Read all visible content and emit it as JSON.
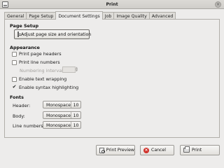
{
  "window": {
    "title": "Print"
  },
  "tabs": [
    "General",
    "Page Setup",
    "Document Settings",
    "Job",
    "Image Quality",
    "Advanced"
  ],
  "active_tab": "Document Settings",
  "page_setup": {
    "heading": "Page Setup",
    "button_label": "Adjust page size and orientation"
  },
  "appearance": {
    "heading": "Appearance",
    "print_page_headers": {
      "label": "Print page headers",
      "checked": false
    },
    "print_line_numbers": {
      "label": "Print line numbers",
      "checked": false
    },
    "numbering_interval": {
      "label": "Numbering interval:",
      "value": "",
      "enabled": false
    },
    "enable_text_wrapping": {
      "label": "Enable text wrapping",
      "checked": false
    },
    "enable_syntax_highlighting": {
      "label": "Enable syntax highlighting",
      "checked": true
    }
  },
  "fonts": {
    "heading": "Fonts",
    "rows": [
      {
        "label": "Header:",
        "font": "Monospace",
        "size": "10"
      },
      {
        "label": "Body:",
        "font": "Monospace",
        "size": "10"
      },
      {
        "label": "Line numbers:",
        "font": "Monospace",
        "size": "10"
      }
    ]
  },
  "buttons": {
    "print_preview": "Print Preview",
    "cancel": "Cancel",
    "print": "Print"
  },
  "icons": {
    "app": "printer-app-icon",
    "close": "close-icon",
    "page_setup": "page-setup-icon",
    "print_preview": "print-preview-icon",
    "cancel": "cancel-icon",
    "print": "printer-icon"
  }
}
